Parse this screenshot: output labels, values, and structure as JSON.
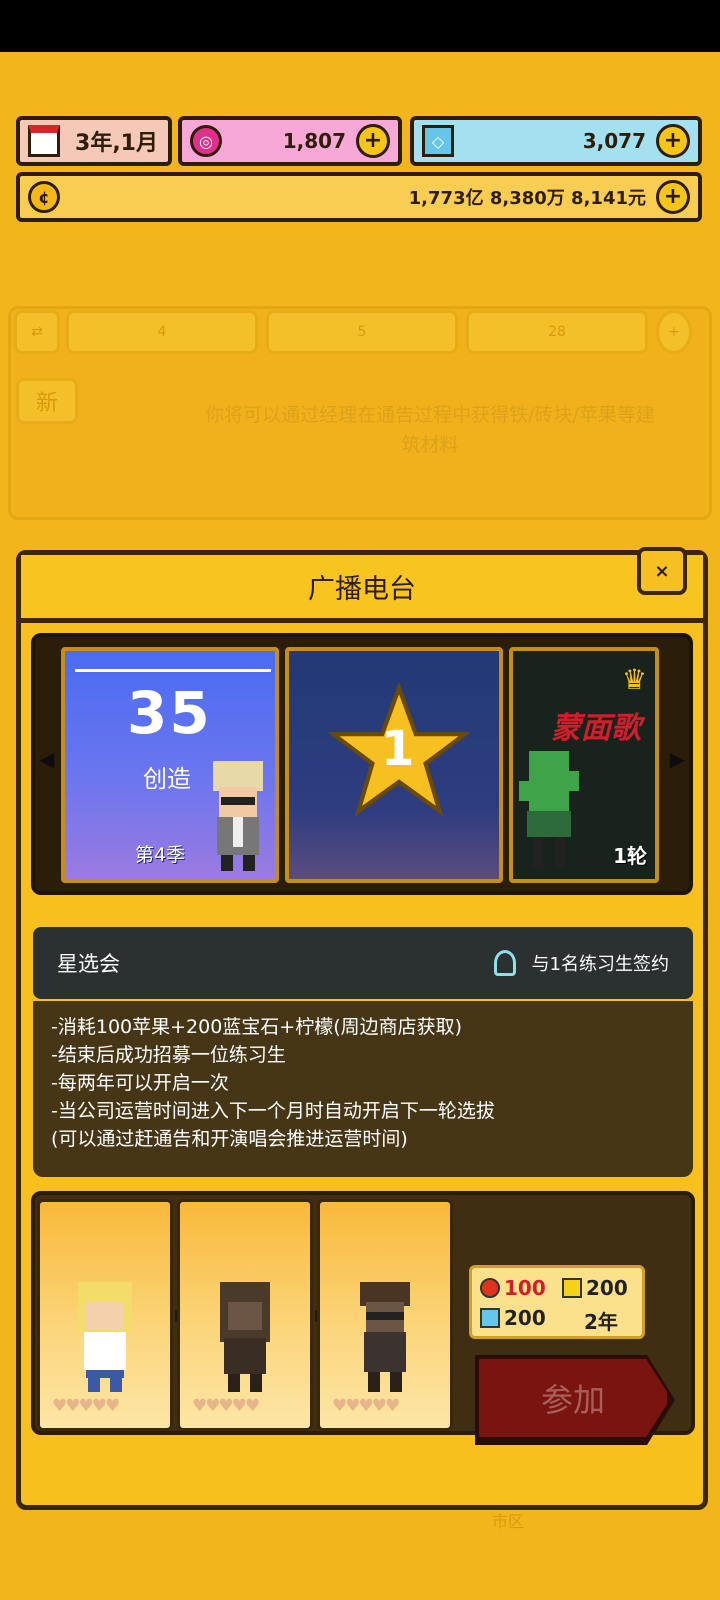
{
  "top": {
    "date": "3年,1月",
    "pink_gems": "1,807",
    "blue_gems": "3,077",
    "money": "1,773亿 8,380万 8,141元"
  },
  "background": {
    "slots": [
      "4",
      "5",
      "28"
    ],
    "new_badge": "新",
    "hint": "你将可以通过经理在通告过程中获得铁/砖块/苹果等建筑材料"
  },
  "dialog": {
    "title": "广播电台",
    "close": "×",
    "cards": [
      {
        "number": "35",
        "name": "创造",
        "season": "第4季"
      },
      {
        "number": "1"
      },
      {
        "title": "蒙面歌",
        "round": "1轮"
      }
    ],
    "event": {
      "name": "星选会",
      "reward": "与1名练习生签约",
      "lines": [
        "-消耗100苹果+200蓝宝石+柠檬(周边商店获取)",
        "-结束后成功招募一位练习生",
        "-每两年可以开启一次",
        "-当公司运营时间进入下一个月时自动开启下一轮选拔",
        "(可以通过赶通告和开演唱会推进运营时间)"
      ]
    },
    "cost": {
      "apple": "100",
      "lemon": "200",
      "sapphire": "200",
      "period": "2年"
    },
    "join_label": "参加"
  },
  "footer_text": "市区",
  "colors": {
    "accent": "#f7c01d",
    "dark": "#3a2608",
    "join_red": "#7a1410"
  }
}
